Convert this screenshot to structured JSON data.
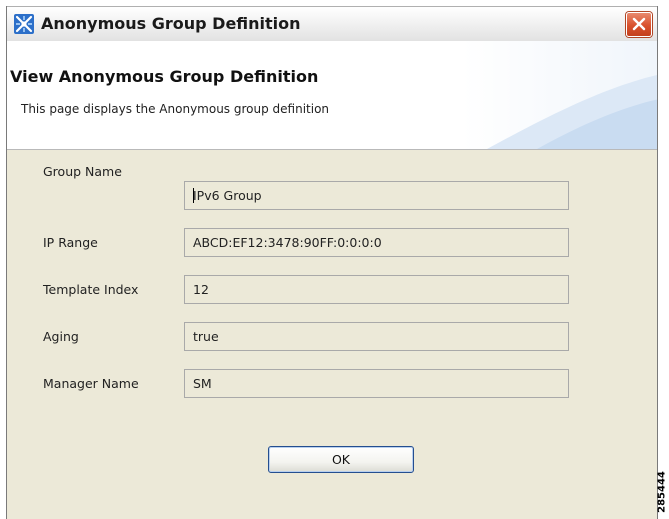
{
  "window": {
    "title": "Anonymous Group Definition",
    "accent_color": "#d9512d"
  },
  "header": {
    "heading": "View Anonymous Group Definition",
    "description": "This page displays the Anonymous group definition"
  },
  "fields": [
    {
      "label": "Group Name",
      "value": "IPv6 Group"
    },
    {
      "label": "IP Range",
      "value": "ABCD:EF12:3478:90FF:0:0:0:0"
    },
    {
      "label": "Template Index",
      "value": "12"
    },
    {
      "label": "Aging",
      "value": "true"
    },
    {
      "label": "Manager Name",
      "value": "SM"
    }
  ],
  "buttons": {
    "ok_label": "OK"
  },
  "figure_id": "285444"
}
